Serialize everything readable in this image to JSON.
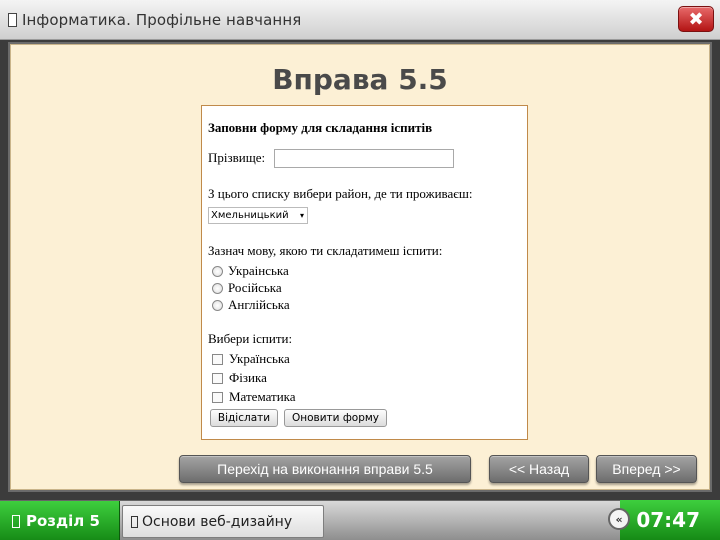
{
  "window": {
    "title": "Інформатика. Профільне навчання",
    "close_symbol": "✖"
  },
  "main": {
    "title": "Вправа 5.5"
  },
  "form": {
    "heading": "Заповни форму для складання іспитів",
    "surname_label": "Прізвище:",
    "surname_value": "",
    "district_label": "З цього списку вибери район, де ти проживаєш:",
    "district_selected": "Хмельницький",
    "language_label": "Зазнач мову, якою ти складатимеш іспити:",
    "languages": [
      "Украінська",
      "Російська",
      "Англійська"
    ],
    "exams_label": "Вибери іспити:",
    "exams": [
      "Українська",
      "Фізика",
      "Математика"
    ],
    "submit_label": "Відіслати",
    "reset_label": "Оновити форму"
  },
  "nav": {
    "go_exercise": "Перехід на виконання вправи 5.5",
    "back": "<< Назад",
    "forward": "Вперед >>"
  },
  "bottom": {
    "section": "Розділ 5",
    "topic": "Основи веб-дизайну",
    "time": "07:47"
  },
  "colors": {
    "accent_green": "#22a822",
    "close_red": "#c72020",
    "panel_bg": "#fcf0d5"
  },
  "icons": [
    "window-icon",
    "close-icon",
    "section-icon",
    "topic-icon",
    "back-arrow-icon"
  ]
}
